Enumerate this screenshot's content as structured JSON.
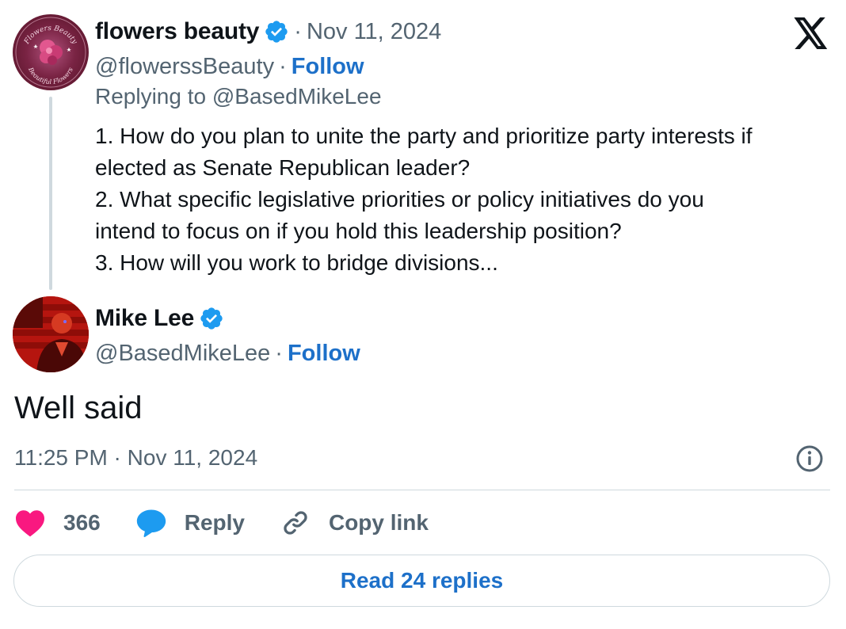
{
  "parent_tweet": {
    "display_name": "flowers beauty",
    "date": "Nov 11, 2024",
    "handle": "@flowerssBeauty",
    "follow_label": "Follow",
    "replying_to_prefix": "Replying to",
    "replying_to_handle": "@BasedMikeLee",
    "avatar_text_top": "Flowers Beauty",
    "avatar_text_bottom": "Beautiful Flowers",
    "body_lines": [
      "1. How do you plan to unite the party and prioritize party interests if",
      "elected as Senate Republican leader?",
      "2. What specific legislative priorities or policy initiatives do you",
      "intend to focus on if you hold this leadership position?",
      "3. How will you work to bridge divisions..."
    ]
  },
  "reply_tweet": {
    "display_name": "Mike Lee",
    "handle": "@BasedMikeLee",
    "follow_label": "Follow",
    "text": "Well said",
    "timestamp": "11:25 PM · Nov 11, 2024"
  },
  "actions": {
    "like_count": "366",
    "reply_label": "Reply",
    "copy_link_label": "Copy link"
  },
  "read_replies_label": "Read 24 replies",
  "separator": "·",
  "icons": {
    "close": "x-logo-icon",
    "verified": "verified-badge-icon",
    "info": "info-icon",
    "like": "heart-icon",
    "reply": "speech-bubble-icon",
    "copy": "link-icon"
  },
  "colors": {
    "link": "#1d70c9",
    "verified": "#1d9bf0",
    "heart": "#f91880",
    "muted": "#536471",
    "text": "#0f1419"
  }
}
